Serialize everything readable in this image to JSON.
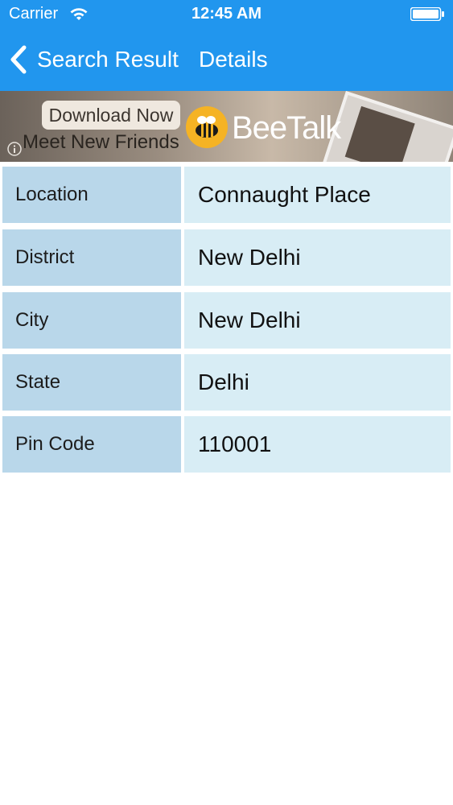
{
  "status_bar": {
    "carrier": "Carrier",
    "time": "12:45 AM"
  },
  "nav": {
    "back_label": "Search Result",
    "title": "Details"
  },
  "ad": {
    "download_label": "Download Now",
    "tagline": "Meet New Friends",
    "brand": "BeeTalk"
  },
  "details": [
    {
      "label": "Location",
      "value": "Connaught Place"
    },
    {
      "label": "District",
      "value": "New Delhi"
    },
    {
      "label": "City",
      "value": "New Delhi"
    },
    {
      "label": "State",
      "value": "Delhi"
    },
    {
      "label": "Pin Code",
      "value": "110001"
    }
  ],
  "colors": {
    "header": "#2196ee",
    "label_cell": "#b9d7ea",
    "value_cell": "#d8edf5"
  }
}
